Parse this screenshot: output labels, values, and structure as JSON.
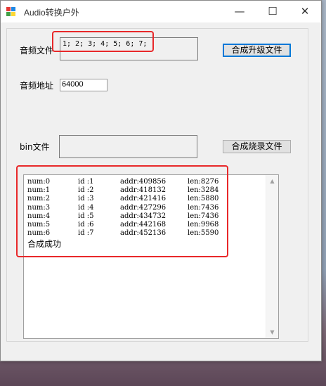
{
  "window": {
    "title": "Audio转换户外",
    "controls": {
      "minimize": "—",
      "maximize": "☐",
      "close": "✕"
    }
  },
  "form": {
    "audio_file_label": "音频文件",
    "audio_file_value": "1; 2; 3; 4; 5; 6; 7;",
    "merge_upgrade_button": "合成升级文件",
    "audio_addr_label": "音频地址",
    "audio_addr_value": "64000",
    "bin_file_label": "bin文件",
    "bin_file_value": "",
    "merge_burn_button": "合成烧录文件"
  },
  "log": {
    "rows": [
      {
        "num": "num:0",
        "id": "id :1",
        "addr": "addr:409856",
        "len": "len:8276"
      },
      {
        "num": "num:1",
        "id": "id :2",
        "addr": "addr:418132",
        "len": "len:3284"
      },
      {
        "num": "num:2",
        "id": "id :3",
        "addr": "addr:421416",
        "len": "len:5880"
      },
      {
        "num": "num:3",
        "id": "id :4",
        "addr": "addr:427296",
        "len": "len:7436"
      },
      {
        "num": "num:4",
        "id": "id :5",
        "addr": "addr:434732",
        "len": "len:7436"
      },
      {
        "num": "num:5",
        "id": "id :6",
        "addr": "addr:442168",
        "len": "len:9968"
      },
      {
        "num": "num:6",
        "id": "id :7",
        "addr": "addr:452136",
        "len": "len:5590"
      }
    ],
    "status": "合成成功"
  },
  "colors": {
    "highlight": "#e8282a",
    "default_button_border": "#0078d7"
  }
}
